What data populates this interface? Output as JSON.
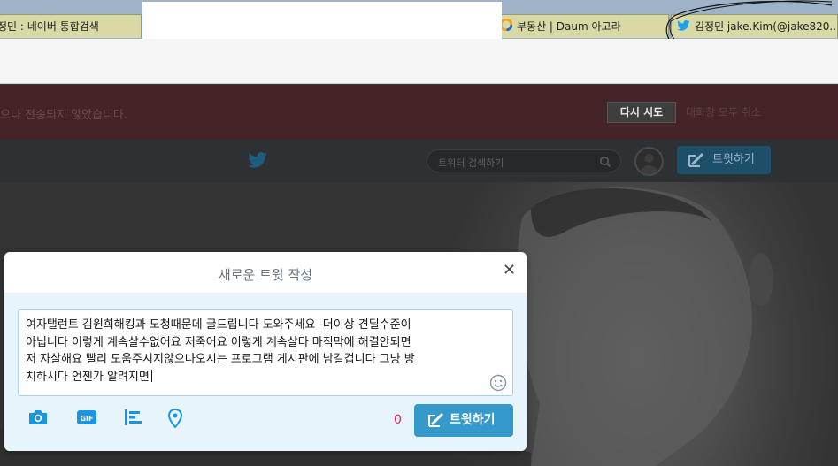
{
  "browser": {
    "tabs": [
      {
        "label": "정민 : 네이버 통합검색"
      },
      {
        "label": "부동산 | Daum 아고라",
        "icon": "daum-icon"
      },
      {
        "label": "김정민 jake.Kim(@jake820...",
        "icon": "twitter-bird-icon"
      }
    ]
  },
  "notice": {
    "message": "으나 전송되지 않았습니다.",
    "retry_label": "다시 시도",
    "later_label": "대화창 모두 취소"
  },
  "nav": {
    "search_placeholder": "트위터 검색하기",
    "tweet_button_label": "트윗하기"
  },
  "compose": {
    "title": "새로운 트윗 작성",
    "text": "여자탤런트 김원희해킹과 도청때문데 글드립니다 도와주세요  더이상 견딜수준이\n아닙니다 이렇게 계속살수없어요 저죽어요 이렇게 계속살다 마직막에 해결안되면\n저 자살해요 빨리 도움주시지않으나오시는 프로그램 게시판에 남길겁니다 그냥 방\n치하시다 언젠가 알려지면",
    "char_count": "0",
    "submit_label": "트윗하기",
    "gif_label": "GIF"
  },
  "colors": {
    "accent": "#3599cc",
    "counter": "#e0245e",
    "twitter_blue": "#1da1f2"
  }
}
